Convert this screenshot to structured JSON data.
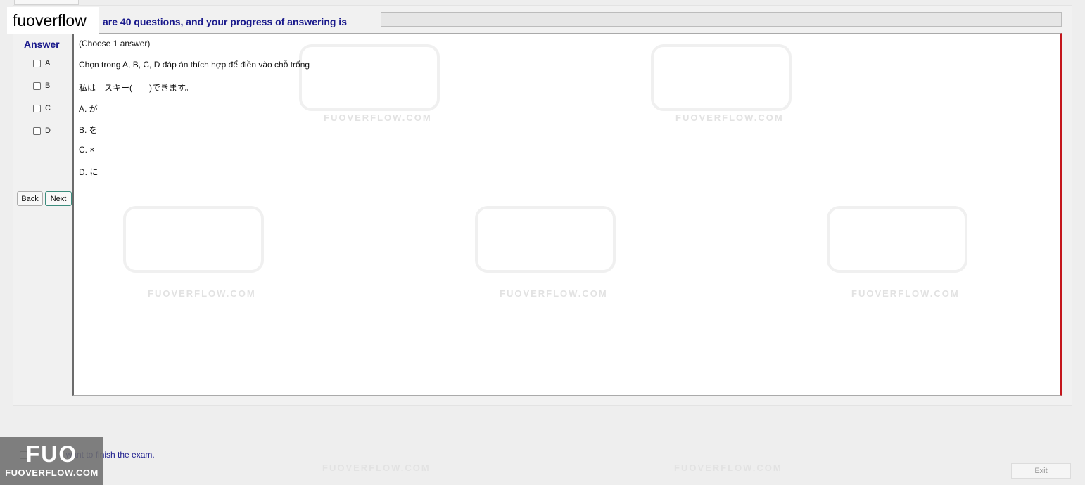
{
  "brand": {
    "chip_text": "fuoverflow"
  },
  "header": {
    "progress_text": "are 40 questions, and your progress of answering is",
    "progress_value_percent": 0
  },
  "answer_panel": {
    "title": "Answer",
    "options": [
      {
        "label": "A",
        "checked": false
      },
      {
        "label": "B",
        "checked": false
      },
      {
        "label": "C",
        "checked": false
      },
      {
        "label": "D",
        "checked": false
      }
    ],
    "back_label": "Back",
    "next_label": "Next"
  },
  "question": {
    "instruction": "(Choose 1 answer)",
    "prompt": "Chọn trong A, B, C, D đáp án thích hợp để điền vào chỗ trống",
    "sentence": "私は　スキー(　　)できます。",
    "choices": [
      "A. が",
      "B. を",
      "C. ×",
      "D. に"
    ]
  },
  "footer": {
    "finish_text": "I want to finish the exam.",
    "finish_checked": false,
    "exit_label": "Exit"
  },
  "watermark": {
    "logo": "FUO",
    "site": "FUOVERFLOW.COM"
  },
  "colors": {
    "accent_border": "#c4161c",
    "heading_text": "#1a1a8c"
  }
}
